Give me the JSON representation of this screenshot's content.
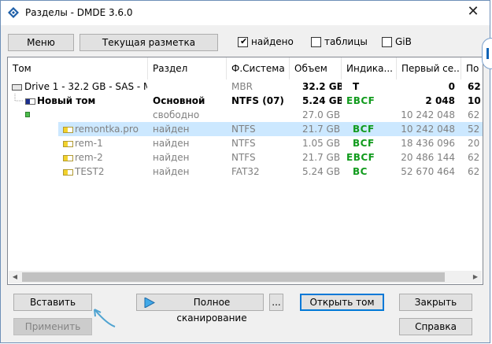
{
  "window": {
    "title": "Разделы - DMDE 3.6.0"
  },
  "toolbar": {
    "menu_label": "Меню",
    "layout_label": "Текущая разметка",
    "found_label": "найдено",
    "found_checked": true,
    "tables_label": "таблицы",
    "tables_checked": false,
    "gib_label": "GiB",
    "gib_checked": false
  },
  "list": {
    "columns": [
      "Том",
      "Раздел",
      "Ф.Система",
      "Объем",
      "Индика...",
      "Первый се...",
      "По"
    ],
    "rows": [
      {
        "name": "Drive 1 - 32.2 GB - SAS - M...",
        "partition": "",
        "fs": "MBR",
        "size": "32.2 GB",
        "ind": "T",
        "first": "0",
        "last": "62",
        "icon": "drive"
      },
      {
        "name": "Новый том",
        "partition": "Основной",
        "fs": "NTFS (07)",
        "size": "5.24 GB",
        "ind": "EBCF",
        "first": "2 048",
        "last": "10",
        "icon": "volume"
      },
      {
        "name": "",
        "partition": "свободно",
        "fs": "",
        "size": "27.0 GB",
        "ind": "",
        "first": "10 242 048",
        "last": "62",
        "icon": "free"
      },
      {
        "name": "remontka.pro",
        "partition": "найден",
        "fs": "NTFS",
        "size": "21.7 GB",
        "ind": "BCF",
        "first": "10 242 048",
        "last": "52",
        "icon": "part"
      },
      {
        "name": "rem-1",
        "partition": "найден",
        "fs": "NTFS",
        "size": "1.05 GB",
        "ind": "BCF",
        "first": "18 436 096",
        "last": "20",
        "icon": "part"
      },
      {
        "name": "rem-2",
        "partition": "найден",
        "fs": "NTFS",
        "size": "21.7 GB",
        "ind": "EBCF",
        "first": "20 486 144",
        "last": "62",
        "icon": "part"
      },
      {
        "name": "TEST2",
        "partition": "найден",
        "fs": "FAT32",
        "size": "5.24 GB",
        "ind": "BC",
        "first": "52 670 464",
        "last": "62",
        "icon": "part"
      }
    ]
  },
  "buttons": {
    "insert": "Вставить",
    "apply": "Применить",
    "full_scan": "Полное сканирование",
    "more": "...",
    "open_volume": "Открыть том",
    "close": "Закрыть",
    "help": "Справка"
  },
  "colors": {
    "accent": "#0078d7",
    "selection": "#cce8ff",
    "indicator_green": "#119b1d",
    "annotation_arrow": "#4fa3d1"
  }
}
